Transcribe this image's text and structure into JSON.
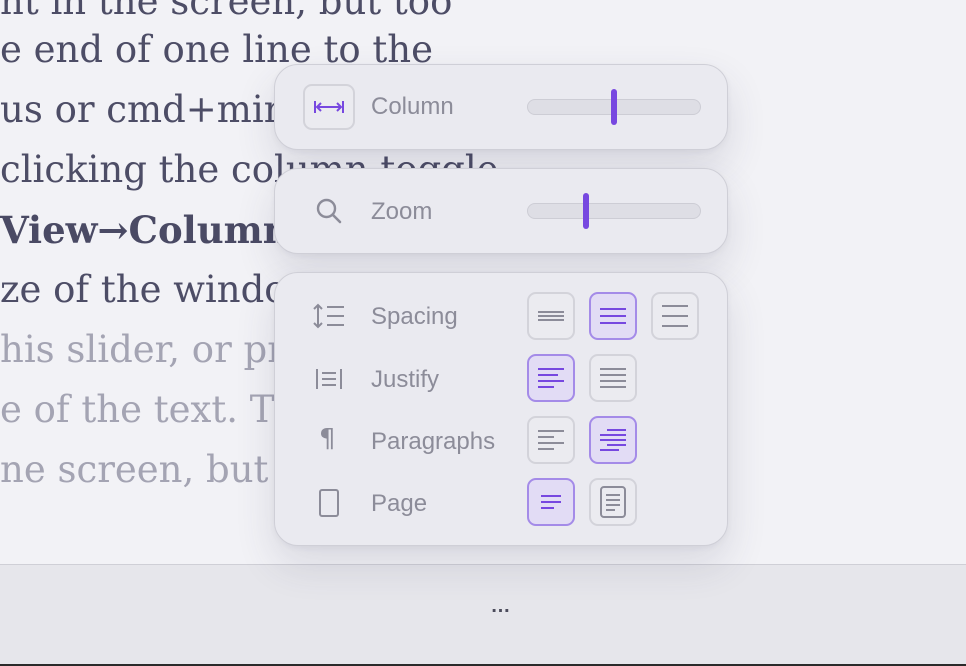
{
  "document": {
    "lines": [
      {
        "text": "nt in the screen, but too",
        "faded": false
      },
      {
        "text": "e end of one line to the",
        "faded": false
      },
      {
        "text": "us or cmd+min",
        "faded": false
      },
      {
        "text": " clicking the column toggle",
        "faded": false
      },
      {
        "text": "View→Column.",
        "faded": false,
        "bold": true
      },
      {
        "text": "ze of the windo",
        "faded": false
      },
      {
        "text": "his slider, or pr",
        "faded": true
      },
      {
        "text": "e of the text. Th",
        "faded": true
      },
      {
        "text": "ne screen, but to",
        "faded": true
      }
    ]
  },
  "settings": {
    "column": {
      "label": "Column",
      "icon": "column-width-icon",
      "value": 0.5
    },
    "zoom": {
      "label": "Zoom",
      "icon": "search-icon",
      "value": 0.34
    },
    "spacing": {
      "label": "Spacing",
      "icon": "line-spacing-icon",
      "options": [
        {
          "name": "spacing-tight",
          "selected": false
        },
        {
          "name": "spacing-normal",
          "selected": true
        },
        {
          "name": "spacing-loose",
          "selected": false
        }
      ]
    },
    "justify": {
      "label": "Justify",
      "icon": "justify-icon",
      "options": [
        {
          "name": "justify-left",
          "selected": true
        },
        {
          "name": "justify-full",
          "selected": false
        }
      ]
    },
    "paragraphs": {
      "label": "Paragraphs",
      "icon": "pilcrow-icon",
      "options": [
        {
          "name": "paragraph-spacing",
          "selected": false
        },
        {
          "name": "paragraph-indent",
          "selected": true
        }
      ]
    },
    "page": {
      "label": "Page",
      "icon": "page-icon",
      "options": [
        {
          "name": "page-off",
          "selected": true
        },
        {
          "name": "page-on",
          "selected": false
        }
      ]
    }
  },
  "bottom_bar": {
    "more_label": "…"
  },
  "colors": {
    "accent": "#7748e0",
    "muted": "#8c8c99",
    "panel": "#eaeaf0"
  }
}
